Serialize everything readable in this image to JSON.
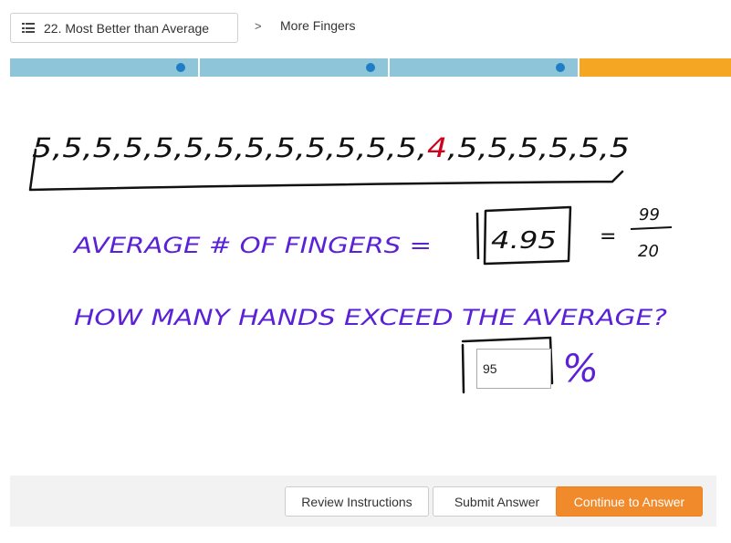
{
  "nav": {
    "lesson_button_label": "22. Most Better than Average",
    "breadcrumb_separator": ">",
    "current_step": "More Fingers"
  },
  "progress": {
    "segments": [
      {
        "state": "complete",
        "color": "#8ec5d9",
        "has_dot": true
      },
      {
        "state": "complete",
        "color": "#8ec5d9",
        "has_dot": true
      },
      {
        "state": "complete",
        "color": "#8ec5d9",
        "has_dot": true
      },
      {
        "state": "current",
        "color": "#f5a623",
        "has_dot": false
      }
    ],
    "dot_color": "#1f7fc4"
  },
  "whiteboard": {
    "numbers_row": "5,5,5,5,5,5,5,5,5,5,5,5,5,4,5,5,5,5,5,5",
    "highlight_value": "4",
    "average_label": "AVERAGE # OF FINGERS =",
    "average_value": "4.95",
    "fraction_equals": "=",
    "fraction_numerator": "99",
    "fraction_denominator": "20",
    "question": "HOW MANY HANDS EXCEED THE AVERAGE?",
    "percent_sign": "%",
    "ink_black": "#111111",
    "ink_red": "#d0021b",
    "ink_purple": "#5b21d6"
  },
  "answer": {
    "value": "95"
  },
  "footer": {
    "review_label": "Review Instructions",
    "submit_label": "Submit Answer",
    "continue_label": "Continue to Answer",
    "continue_color": "#f08a2b"
  }
}
